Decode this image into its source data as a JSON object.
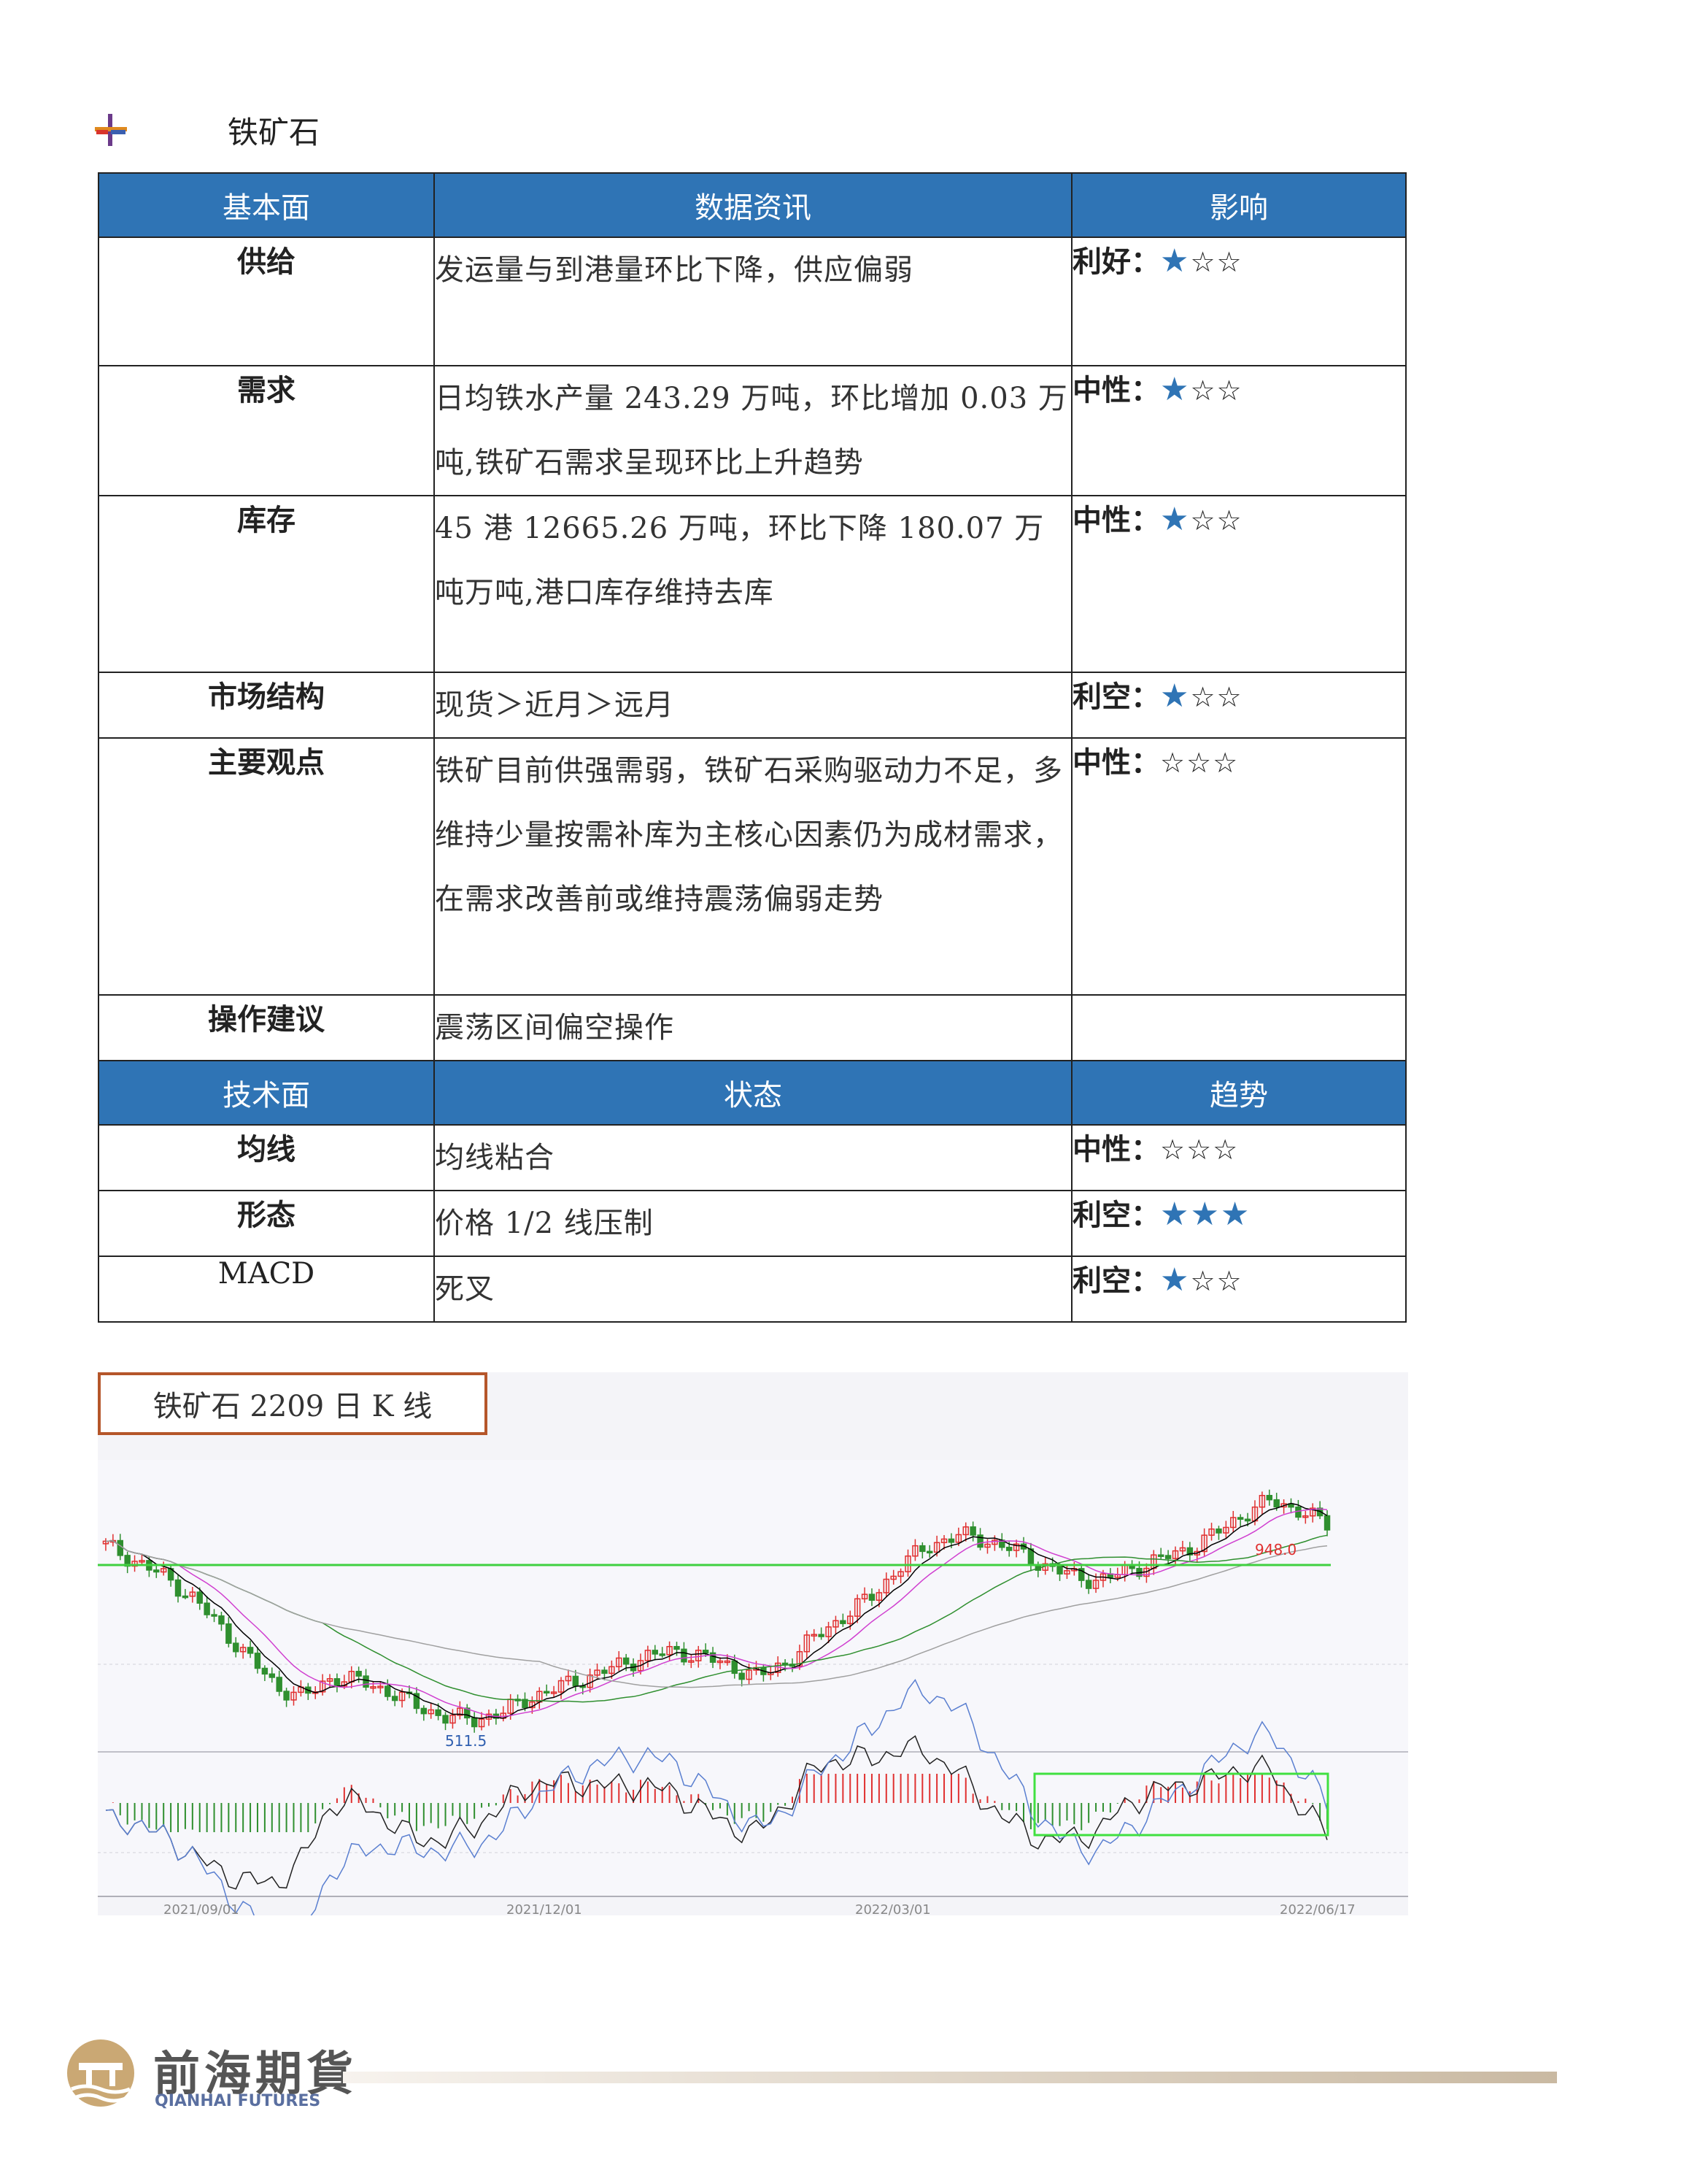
{
  "section": {
    "title": "铁矿石",
    "bullet_icon": "cross-bullet-icon"
  },
  "fundamentals": {
    "headers": [
      "基本面",
      "数据资讯",
      "影响"
    ],
    "rows": [
      {
        "label": "供给",
        "text": "发运量与到港量环比下降，供应偏弱",
        "impact": "利好：",
        "stars": "★☆☆"
      },
      {
        "label": "需求",
        "text": "日均铁水产量 243.29 万吨，环比增加 0.03 万吨,铁矿石需求呈现环比上升趋势",
        "impact": "中性：",
        "stars": "★☆☆"
      },
      {
        "label": "库存",
        "text": "45 港 12665.26 万吨，环比下降 180.07 万吨万吨,港口库存维持去库",
        "impact": "中性：",
        "stars": "★☆☆"
      },
      {
        "label": "市场结构",
        "text": "现货＞近月＞远月",
        "impact": "利空：",
        "stars": "★☆☆"
      },
      {
        "label": "主要观点",
        "text": "铁矿目前供强需弱，铁矿石采购驱动力不足，多维持少量按需补库为主核心因素仍为成材需求，在需求改善前或维持震荡偏弱走势",
        "impact": "中性：",
        "stars": "☆☆☆"
      },
      {
        "label": "操作建议",
        "text": "震荡区间偏空操作",
        "impact": "",
        "stars": ""
      }
    ]
  },
  "technicals": {
    "headers": [
      "技术面",
      "状态",
      "趋势"
    ],
    "rows": [
      {
        "label": "均线",
        "text": "均线粘合",
        "impact": "中性：",
        "stars": "☆☆☆"
      },
      {
        "label": "形态",
        "text": "价格 1/2 线压制",
        "impact": "利空：",
        "stars": "★★★"
      },
      {
        "label": "MACD",
        "text": "死叉",
        "impact": "利空：",
        "stars": "★☆☆"
      }
    ]
  },
  "chart": {
    "title": "铁矿石 2209 日 K 线",
    "high_label": "948.0",
    "low_label": "511.5",
    "dates": [
      "2021/09/01",
      "2021/12/01",
      "2022/03/01",
      "2022/06/17"
    ]
  },
  "chart_data": {
    "type": "candlestick",
    "title": "铁矿石 2209 日 K 线",
    "x_ticks": [
      "2021/09/01",
      "2021/12/01",
      "2022/03/01",
      "2022/06/17"
    ],
    "annotations": [
      {
        "label": "948.0",
        "value": 948.0
      },
      {
        "label": "511.5",
        "value": 511.5
      }
    ],
    "price_trend": [
      860,
      830,
      800,
      760,
      700,
      640,
      580,
      560,
      600,
      590,
      570,
      540,
      520,
      515,
      530,
      560,
      580,
      600,
      620,
      640,
      650,
      640,
      620,
      600,
      630,
      680,
      720,
      760,
      820,
      860,
      880,
      870,
      850,
      820,
      800,
      790,
      810,
      830,
      850,
      880,
      920,
      948,
      930,
      900
    ],
    "colors": {
      "up": "#e03030",
      "down": "#2f8f2f",
      "resistance": "#40d040"
    }
  },
  "footer": {
    "brand_cn": "前海期貨",
    "brand_en": "QIANHAI FUTURES"
  }
}
